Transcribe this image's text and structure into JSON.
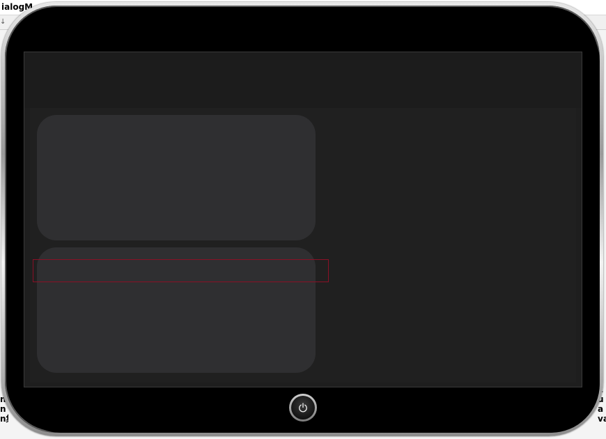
{
  "host": {
    "title": "ialogM",
    "left_glyph": "↓",
    "left_edge_text": "n\nn\nn集",
    "right_edge_text": "E\nu\na\nva"
  },
  "device": {
    "type": "tablet",
    "power_button_icon": "power-icon"
  },
  "screen": {
    "header_text": "",
    "cards": [
      {
        "name": "card-top",
        "text": ""
      },
      {
        "name": "card-bottom",
        "text": ""
      }
    ]
  },
  "colors": {
    "bezel": "#000000",
    "screen_bg": "#1e1e1e",
    "card_bg": "#2f2f31",
    "focus_outline": "#8a1026"
  }
}
